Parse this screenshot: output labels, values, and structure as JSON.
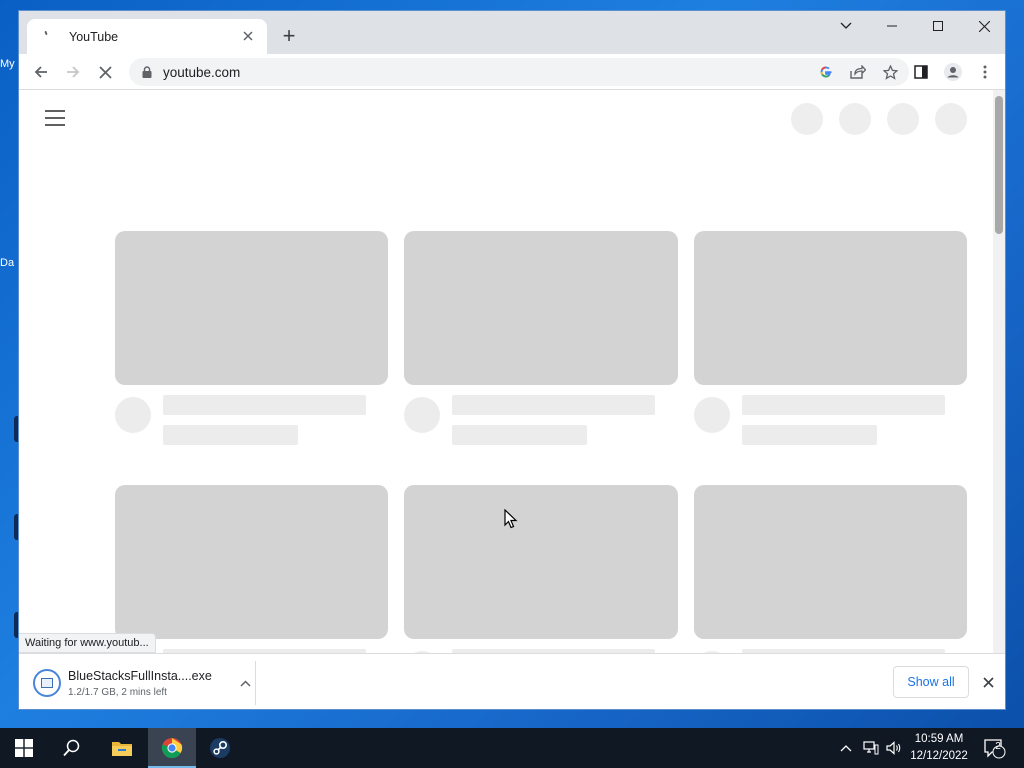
{
  "desktop": {
    "fragments": [
      "My",
      "Da"
    ]
  },
  "browser": {
    "tab_title": "YouTube",
    "new_tab_symbol": "+",
    "url": "youtube.com",
    "status_text": "Waiting for www.youtub...",
    "icons": {
      "back": "arrow-left-icon",
      "forward": "arrow-right-icon",
      "stop": "close-icon",
      "lock": "lock-icon",
      "google": "google-icon",
      "share": "share-icon",
      "bookmark": "star-icon",
      "side_panel": "side-panel-icon",
      "profile": "profile-icon",
      "menu": "kebab-menu-icon"
    }
  },
  "page": {
    "skeleton_cards_rows": 2,
    "skeleton_cards_per_row": 3,
    "header_circles": 4
  },
  "downloads": {
    "file_name": "BlueStacksFullInsta....exe",
    "progress_text": "1.2/1.7 GB, 2 mins left",
    "show_all_label": "Show all"
  },
  "taskbar": {
    "time": "10:59 AM",
    "date": "12/12/2022",
    "notification_count": "2",
    "apps": [
      "start-icon",
      "search-icon",
      "file-explorer-icon",
      "chrome-icon",
      "steam-icon"
    ]
  },
  "colors": {
    "desktop_blue": "#1e7fe0",
    "chrome_frame": "#dee1e6",
    "skeleton_gray": "#d3d3d3",
    "link_blue": "#1a73e8",
    "taskbar": "#101824"
  }
}
